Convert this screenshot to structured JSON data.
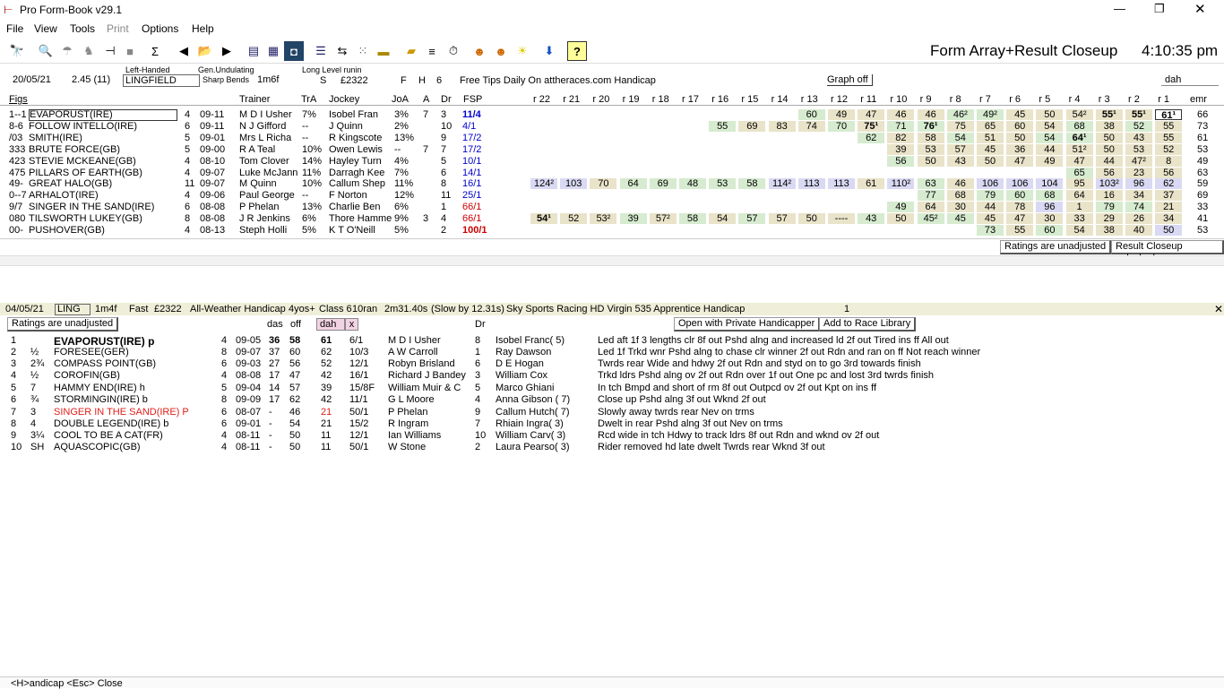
{
  "window": {
    "title": "Pro Form-Book v29.1",
    "controls": {
      "min": "—",
      "max": "❐",
      "close": "✕"
    }
  },
  "menu": [
    "File",
    "View",
    "Tools",
    "Print",
    "Options",
    "Help"
  ],
  "toolbar": {
    "view_title": "Form Array+Result Closeup",
    "time": "4:10:35 pm",
    "help_btn": "?"
  },
  "race": {
    "date": "20/05/21",
    "time": "2.45 (11)",
    "hand": "Left-Handed",
    "course": "LINGFIELD",
    "going": "Gen.Undulating",
    "bends": "Sharp Bends",
    "dist": "1m6f",
    "level": "Long Level runin",
    "s": "S",
    "prize": "£2322",
    "f": "F",
    "h": "H",
    "six": "6",
    "title": "Free Tips Daily On attheraces.com Handicap",
    "graph_btn": "Graph off",
    "search_val": "dah"
  },
  "grid": {
    "headers": {
      "figs": "Figs",
      "trainer": "Trainer",
      "tra": "TrA",
      "jockey": "Jockey",
      "joa": "JoA",
      "a": "A",
      "dr": "Dr",
      "fsp": "FSP",
      "races": [
        "r 22",
        "r 21",
        "r 20",
        "r 19",
        "r 18",
        "r 17",
        "r 16",
        "r 15",
        "r 14",
        "r 13",
        "r 12",
        "r 11",
        "r 10",
        "r 9",
        "r 8",
        "r 7",
        "r 6",
        "r 5",
        "r 4",
        "r 3",
        "r 2",
        "r 1"
      ],
      "emr": "emr"
    },
    "rows": [
      {
        "figs": "1--1",
        "name": "EVAPORUST(IRE)",
        "age": "4",
        "wt": "09-11",
        "trainer": "M D I Usher",
        "tra": "7%",
        "jockey": "Isobel Fran",
        "joa": "3%",
        "a": "7",
        "dr": "3",
        "fsp": "11/4",
        "fsp_col": "#0000cc",
        "fsp_bold": true,
        "r": {
          "r 13": [
            "60",
            "grn"
          ],
          "r 12": [
            "49",
            "tan"
          ],
          "r 11": [
            "47",
            "tan"
          ],
          "r 10": [
            "46",
            "tan"
          ],
          "r 9": [
            "46",
            "tan"
          ],
          "r 8": [
            "46²",
            "grn"
          ],
          "r 7": [
            "49²",
            "grn"
          ],
          "r 6": [
            "45",
            "tan"
          ],
          "r 5": [
            "50",
            "tan"
          ],
          "r 4": [
            "54²",
            "tan"
          ],
          "r 3": [
            "55¹",
            "tan",
            1
          ],
          "r 2": [
            "55¹",
            "tan",
            1
          ],
          "r 1": [
            "61¹",
            "box",
            1
          ]
        },
        "emr": "66"
      },
      {
        "figs": "8-6",
        "name": "FOLLOW INTELLO(IRE)",
        "age": "6",
        "wt": "09-11",
        "trainer": "N J Gifford",
        "tra": "--",
        "jockey": "J Quinn",
        "joa": "2%",
        "a": "",
        "dr": "10",
        "fsp": "4/1",
        "fsp_col": "#0000cc",
        "r": {
          "r 16": [
            "55",
            "grn"
          ],
          "r 15": [
            "69",
            "tan"
          ],
          "r 14": [
            "83",
            "tan"
          ],
          "r 13": [
            "74",
            "tan"
          ],
          "r 12": [
            "70",
            "grn"
          ],
          "r 11": [
            "75¹",
            "tan",
            1
          ],
          "r 10": [
            "71",
            "grn"
          ],
          "r 9": [
            "76¹",
            "grn",
            1
          ],
          "r 8": [
            "75",
            "tan"
          ],
          "r 7": [
            "65",
            "tan"
          ],
          "r 6": [
            "60",
            "tan"
          ],
          "r 5": [
            "54",
            "tan"
          ],
          "r 4": [
            "68",
            "grn"
          ],
          "r 3": [
            "38",
            "tan"
          ],
          "r 2": [
            "52",
            "grn"
          ],
          "r 1": [
            "55",
            "tan"
          ]
        },
        "emr": "73"
      },
      {
        "figs": "/03",
        "name": "SMITH(IRE)",
        "age": "5",
        "wt": "09-01",
        "trainer": "Mrs L Richa",
        "tra": "--",
        "jockey": "R Kingscote",
        "joa": "13%",
        "a": "",
        "dr": "9",
        "fsp": "17/2",
        "fsp_col": "#0000cc",
        "r": {
          "r 11": [
            "62",
            "grn"
          ],
          "r 10": [
            "82",
            "tan"
          ],
          "r 9": [
            "58",
            "tan"
          ],
          "r 8": [
            "54",
            "grn"
          ],
          "r 7": [
            "51",
            "tan"
          ],
          "r 6": [
            "50",
            "tan"
          ],
          "r 5": [
            "54",
            "grn"
          ],
          "r 4": [
            "64¹",
            "grn",
            1
          ],
          "r 3": [
            "50",
            "tan"
          ],
          "r 2": [
            "43",
            "tan"
          ],
          "r 1": [
            "55",
            "tan"
          ]
        },
        "emr": "61"
      },
      {
        "figs": "333",
        "name": "BRUTE FORCE(GB)",
        "age": "5",
        "wt": "09-00",
        "trainer": "R A Teal",
        "tra": "10%",
        "jockey": "Owen Lewis",
        "joa": "--",
        "a": "7",
        "dr": "7",
        "fsp": "17/2",
        "fsp_col": "#0000cc",
        "r": {
          "r 10": [
            "39",
            "tan"
          ],
          "r 9": [
            "53",
            "tan"
          ],
          "r 8": [
            "57",
            "tan"
          ],
          "r 7": [
            "45",
            "tan"
          ],
          "r 6": [
            "36",
            "tan"
          ],
          "r 5": [
            "44",
            "tan"
          ],
          "r 4": [
            "51²",
            "tan"
          ],
          "r 3": [
            "50",
            "tan"
          ],
          "r 2": [
            "53",
            "tan"
          ],
          "r 1": [
            "52",
            "tan"
          ]
        },
        "emr": "53"
      },
      {
        "figs": "423",
        "name": "STEVIE MCKEANE(GB)",
        "age": "4",
        "wt": "08-10",
        "trainer": "Tom Clover",
        "tra": "14%",
        "jockey": "Hayley Turn",
        "joa": "4%",
        "a": "",
        "dr": "5",
        "fsp": "10/1",
        "fsp_col": "#0000cc",
        "r": {
          "r 10": [
            "56",
            "grn"
          ],
          "r 9": [
            "50",
            "tan"
          ],
          "r 8": [
            "43",
            "tan"
          ],
          "r 7": [
            "50",
            "tan"
          ],
          "r 6": [
            "47",
            "tan"
          ],
          "r 5": [
            "49",
            "tan"
          ],
          "r 4": [
            "47",
            "tan"
          ],
          "r 3": [
            "44",
            "tan"
          ],
          "r 2": [
            "47²",
            "tan"
          ],
          "r 1": [
            "8",
            "tan"
          ]
        },
        "emr": "49"
      },
      {
        "figs": "475",
        "name": "PILLARS OF EARTH(GB)",
        "age": "4",
        "wt": "09-07",
        "trainer": "Luke McJann",
        "tra": "11%",
        "jockey": "Darragh Kee",
        "joa": "7%",
        "a": "",
        "dr": "6",
        "fsp": "14/1",
        "fsp_col": "#0000cc",
        "r": {
          "r 4": [
            "65",
            "grn"
          ],
          "r 3": [
            "56",
            "tan"
          ],
          "r 2": [
            "23",
            "tan"
          ],
          "r 1": [
            "56",
            "tan"
          ]
        },
        "emr": "63"
      },
      {
        "figs": "49-",
        "name": "GREAT HALO(GB)",
        "age": "11",
        "wt": "09-07",
        "trainer": "M Quinn",
        "tra": "10%",
        "jockey": "Callum Shep",
        "joa": "11%",
        "a": "",
        "dr": "8",
        "fsp": "16/1",
        "fsp_col": "#0000cc",
        "r": {
          "r 22": [
            "124²",
            "blu"
          ],
          "r 21": [
            "103",
            "blu"
          ],
          "r 20": [
            "70",
            "tan"
          ],
          "r 19": [
            "64",
            "grn"
          ],
          "r 18": [
            "69",
            "grn"
          ],
          "r 17": [
            "48",
            "grn"
          ],
          "r 16": [
            "53",
            "grn"
          ],
          "r 15": [
            "58",
            "grn"
          ],
          "r 14": [
            "114²",
            "blu"
          ],
          "r 13": [
            "113",
            "blu"
          ],
          "r 12": [
            "113",
            "blu"
          ],
          "r 11": [
            "61",
            "tan"
          ],
          "r 10": [
            "110²",
            "blu"
          ],
          "r 9": [
            "63",
            "grn"
          ],
          "r 8": [
            "46",
            "tan"
          ],
          "r 7": [
            "106",
            "blu"
          ],
          "r 6": [
            "106",
            "blu"
          ],
          "r 5": [
            "104",
            "blu"
          ],
          "r 4": [
            "95",
            "tan"
          ],
          "r 3": [
            "103²",
            "blu"
          ],
          "r 2": [
            "96",
            "blu"
          ],
          "r 1": [
            "62",
            "blu"
          ]
        },
        "emr": "59"
      },
      {
        "figs": "0--7",
        "name": "ARHALOT(IRE)",
        "age": "4",
        "wt": "09-06",
        "trainer": "Paul George",
        "tra": "--",
        "jockey": "F Norton",
        "joa": "12%",
        "a": "",
        "dr": "11",
        "fsp": "25/1",
        "fsp_col": "#0000cc",
        "r": {
          "r 9": [
            "77",
            "grn"
          ],
          "r 8": [
            "68",
            "tan"
          ],
          "r 7": [
            "79",
            "grn"
          ],
          "r 6": [
            "60",
            "grn"
          ],
          "r 5": [
            "68",
            "grn"
          ],
          "r 4": [
            "64",
            "tan"
          ],
          "r 3": [
            "16",
            "tan"
          ],
          "r 2": [
            "34",
            "tan"
          ],
          "r 1": [
            "37",
            "tan"
          ]
        },
        "emr": "69"
      },
      {
        "figs": "9/7",
        "name": "SINGER IN THE SAND(IRE)",
        "age": "6",
        "wt": "08-08",
        "trainer": "P Phelan",
        "tra": "13%",
        "jockey": "Charlie Ben",
        "joa": "6%",
        "a": "",
        "dr": "1",
        "fsp": "66/1",
        "fsp_col": "#cc0000",
        "r": {
          "r 10": [
            "49",
            "grn"
          ],
          "r 9": [
            "64",
            "tan"
          ],
          "r 8": [
            "30",
            "tan"
          ],
          "r 7": [
            "44",
            "tan"
          ],
          "r 6": [
            "78",
            "tan"
          ],
          "r 5": [
            "96",
            "blu"
          ],
          "r 4": [
            "1",
            "tan"
          ],
          "r 3": [
            "79",
            "grn"
          ],
          "r 2": [
            "74",
            "grn"
          ],
          "r 1": [
            "21",
            "tan"
          ]
        },
        "emr": "33"
      },
      {
        "figs": "080",
        "name": "TILSWORTH LUKEY(GB)",
        "age": "8",
        "wt": "08-08",
        "trainer": "J R Jenkins",
        "tra": "6%",
        "jockey": "Thore Hamme",
        "joa": "9%",
        "a": "3",
        "dr": "4",
        "fsp": "66/1",
        "fsp_col": "#cc0000",
        "r": {
          "r 22": [
            "54¹",
            "tan",
            1
          ],
          "r 21": [
            "52",
            "tan"
          ],
          "r 20": [
            "53²",
            "tan"
          ],
          "r 19": [
            "39",
            "grn"
          ],
          "r 18": [
            "57²",
            "tan"
          ],
          "r 17": [
            "58",
            "grn"
          ],
          "r 16": [
            "54",
            "tan"
          ],
          "r 15": [
            "57",
            "grn"
          ],
          "r 14": [
            "57",
            "tan"
          ],
          "r 13": [
            "50",
            "tan"
          ],
          "r 12": [
            "----",
            "tan"
          ],
          "r 11": [
            "43",
            "grn"
          ],
          "r 10": [
            "50",
            "tan"
          ],
          "r 9": [
            "45²",
            "grn"
          ],
          "r 8": [
            "45",
            "grn"
          ],
          "r 7": [
            "45",
            "tan"
          ],
          "r 6": [
            "47",
            "tan"
          ],
          "r 5": [
            "30",
            "tan"
          ],
          "r 4": [
            "33",
            "tan"
          ],
          "r 3": [
            "29",
            "tan"
          ],
          "r 2": [
            "26",
            "tan"
          ],
          "r 1": [
            "34",
            "tan"
          ]
        },
        "emr": "41"
      },
      {
        "figs": "00-",
        "name": "PUSHOVER(GB)",
        "age": "4",
        "wt": "08-13",
        "trainer": "Steph Holli",
        "tra": "5%",
        "jockey": "K T O'Neill",
        "joa": "5%",
        "a": "",
        "dr": "2",
        "fsp": "100/1",
        "fsp_col": "#cc0000",
        "fsp_bold": true,
        "r": {
          "r 7": [
            "73",
            "grn"
          ],
          "r 6": [
            "55",
            "tan"
          ],
          "r 5": [
            "60",
            "grn"
          ],
          "r 4": [
            "54",
            "tan"
          ],
          "r 3": [
            "38",
            "tan"
          ],
          "r 2": [
            "40",
            "tan"
          ],
          "r 1": [
            "50",
            "blu"
          ]
        },
        "emr": "53"
      }
    ],
    "status_left": "Ratings are unadjusted",
    "status_right": "Result Closeup unlocked"
  },
  "result": {
    "header": {
      "date": "04/05/21",
      "course": "LING",
      "dist": "1m4f",
      "going": "Fast",
      "prize": "£2322",
      "type": "All-Weather Handicap",
      "ages": "4yos+",
      "cls": "Class 6",
      "ran": "10ran",
      "time": "2m31.40s",
      "slow": "(Slow by 12.31s)",
      "title": "Sky Sports Racing HD Virgin 535 Apprentice Handicap",
      "num": "1",
      "close": "✕"
    },
    "ratings_label": "Ratings are unadjusted",
    "col_das": "das",
    "col_off": "off",
    "col_dah": "dah",
    "col_x": "x",
    "col_dr": "Dr",
    "private_btn": "Open with Private Handicapper",
    "library_btn": "Add to Race Library",
    "rows": [
      {
        "pos": "1",
        "btn": "",
        "name": "EVAPORUST(IRE)",
        "suf": "p",
        "age": "4",
        "wt": "09-05",
        "das": "36",
        "off": "58",
        "dah": "61",
        "sp": "6/1",
        "trainer": "M D I Usher",
        "dr": "8",
        "jockey": "Isobel Franc( 5)",
        "comment": "Led aft 1f 3 lengths clr 8f out Pshd alng and increased ld 2f out Tired ins ff All out",
        "bold": true
      },
      {
        "pos": "2",
        "btn": "½",
        "name": "FORESEE(GER)",
        "suf": "",
        "age": "8",
        "wt": "09-07",
        "das": "37",
        "off": "60",
        "dah": "62",
        "sp": "10/3",
        "trainer": "A W Carroll",
        "dr": "1",
        "jockey": "Ray Dawson",
        "comment": "Led 1f Trkd wnr Pshd alng to chase clr winner 2f out Rdn and ran on ff Not reach winner"
      },
      {
        "pos": "3",
        "btn": "2¾",
        "name": "COMPASS POINT(GB)",
        "suf": "",
        "age": "6",
        "wt": "09-03",
        "das": "27",
        "off": "56",
        "dah": "52",
        "sp": "12/1",
        "trainer": "Robyn Brisland",
        "dr": "6",
        "jockey": "D E Hogan",
        "comment": "Twrds rear Wide and hdwy 2f out Rdn and styd on to go 3rd towards finish"
      },
      {
        "pos": "4",
        "btn": "½",
        "name": "COROFIN(GB)",
        "suf": "",
        "age": "4",
        "wt": "08-08",
        "das": "17",
        "off": "47",
        "dah": "42",
        "sp": "16/1",
        "trainer": "Richard J Bandey",
        "dr": "3",
        "jockey": "William Cox",
        "comment": "Trkd ldrs Pshd alng ov 2f out Rdn over 1f out One pc and lost 3rd twrds finish"
      },
      {
        "pos": "5",
        "btn": "7",
        "name": "HAMMY END(IRE)",
        "suf": "h",
        "age": "5",
        "wt": "09-04",
        "das": "14",
        "off": "57",
        "dah": "39",
        "sp": "15/8F",
        "trainer": "William Muir & C",
        "dr": "5",
        "jockey": "Marco Ghiani",
        "comment": "In tch Bmpd and short of rm 8f out Outpcd ov 2f out Kpt on ins ff"
      },
      {
        "pos": "6",
        "btn": "¾",
        "name": "STORMINGIN(IRE)",
        "suf": "b",
        "age": "8",
        "wt": "09-09",
        "das": "17",
        "off": "62",
        "dah": "42",
        "sp": "11/1",
        "trainer": "G L Moore",
        "dr": "4",
        "jockey": "Anna Gibson ( 7)",
        "comment": "Close up Pshd alng 3f out Wknd 2f out"
      },
      {
        "pos": "7",
        "btn": "3",
        "name": "SINGER IN THE SAND(IRE)",
        "suf": "P",
        "age": "6",
        "wt": "08-07",
        "das": "-",
        "off": "46",
        "dah": "21",
        "sp": "50/1",
        "trainer": "P Phelan",
        "dr": "9",
        "jockey": "Callum Hutch( 7)",
        "comment": "Slowly away twrds rear Nev on trms",
        "red": true
      },
      {
        "pos": "8",
        "btn": "4",
        "name": "DOUBLE LEGEND(IRE)",
        "suf": "b",
        "age": "6",
        "wt": "09-01",
        "das": "-",
        "off": "54",
        "dah": "21",
        "sp": "15/2",
        "trainer": "R Ingram",
        "dr": "7",
        "jockey": "Rhiain Ingra( 3)",
        "comment": "Dwelt in rear Pshd alng 3f out Nev on trms"
      },
      {
        "pos": "9",
        "btn": "3¼",
        "name": "COOL TO BE A CAT(FR)",
        "suf": "",
        "age": "4",
        "wt": "08-11",
        "das": "-",
        "off": "50",
        "dah": "11",
        "sp": "12/1",
        "trainer": "Ian Williams",
        "dr": "10",
        "jockey": "William Carv( 3)",
        "comment": "Rcd wide in tch Hdwy to track ldrs 8f out Rdn and wknd ov 2f out"
      },
      {
        "pos": "10",
        "btn": "SH",
        "name": "AQUASCOPIC(GB)",
        "suf": "",
        "age": "4",
        "wt": "08-11",
        "das": "-",
        "off": "50",
        "dah": "11",
        "sp": "50/1",
        "trainer": "W Stone",
        "dr": "2",
        "jockey": "Laura Pearso( 3)",
        "comment": "Rider removed hd late dwelt Twrds rear Wknd 3f out"
      }
    ]
  },
  "footer": "<H>andicap <Esc> Close"
}
